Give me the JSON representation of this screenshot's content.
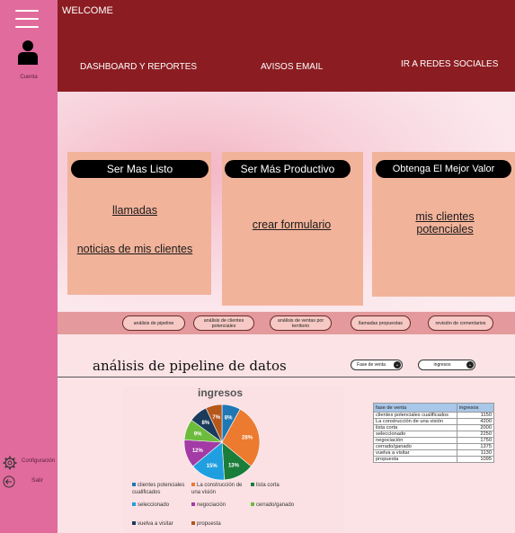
{
  "sidebar": {
    "account_label": "Cuenta",
    "settings_label": "Configuración",
    "logout_label": "Salir"
  },
  "header": {
    "welcome": "WELCOME",
    "nav": [
      "DASHBOARD Y REPORTES",
      "AVISOS EMAIL",
      "IR A REDES SOCIALES"
    ]
  },
  "cards": [
    {
      "title": "Ser Mas Listo",
      "links": [
        "llamadas",
        "noticias de mis clientes"
      ]
    },
    {
      "title": "Ser Más Productivo",
      "links": [
        "crear formulario"
      ]
    },
    {
      "title": "Obtenga El Mejor Valor",
      "links": [
        "mis clientes potenciales"
      ]
    }
  ],
  "subnav": [
    "análisis de pipeline",
    "análisis de clientes potenciales",
    "análisis de ventas por territorio",
    "llamadas propuestas",
    "revisión de comentarios"
  ],
  "section": {
    "title": "análisis de pipeline de datos",
    "filters": [
      "Fase de venta",
      "ingresos"
    ]
  },
  "chart_data": {
    "type": "pie",
    "title": "ingresos",
    "series": [
      {
        "label": "clientes potenciales cualificados",
        "value": 8,
        "color": "#1f77b4"
      },
      {
        "label": "La construcción de una visión",
        "value": 28,
        "color": "#ec7a2f"
      },
      {
        "label": "lista corta",
        "value": 13,
        "color": "#1b7d3a"
      },
      {
        "label": "seleccionado",
        "value": 15,
        "color": "#1f9fe0"
      },
      {
        "label": "negociación",
        "value": 12,
        "color": "#a33aa6"
      },
      {
        "label": "cerrado/ganado",
        "value": 9,
        "color": "#6dbb3c"
      },
      {
        "label": "vuelva a visitar",
        "value": 8,
        "color": "#1a3b5c"
      },
      {
        "label": "propuesta",
        "value": 7,
        "color": "#b5571b"
      }
    ],
    "legend_order": [
      0,
      1,
      2,
      3,
      4,
      5,
      6,
      7
    ]
  },
  "table": {
    "headers": [
      "fase de venta",
      "ingresos"
    ],
    "rows": [
      [
        "clientes potenciales cualificados",
        "1150"
      ],
      [
        "La construcción de una visión",
        "4200"
      ],
      [
        "lista corta",
        "2000"
      ],
      [
        "seleccionado",
        "2250"
      ],
      [
        "negociación",
        "1750"
      ],
      [
        "cerrado/ganado",
        "1375"
      ],
      [
        "vuelva a visitar",
        "1130"
      ],
      [
        "propuesta",
        "1095"
      ]
    ]
  }
}
